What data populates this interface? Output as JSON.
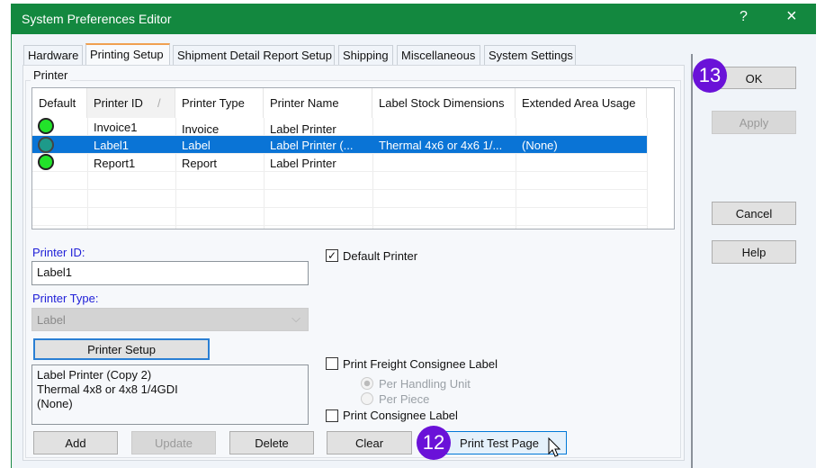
{
  "window": {
    "title": "System Preferences Editor",
    "help": "?",
    "close": "×"
  },
  "tabs": [
    {
      "label": "Hardware"
    },
    {
      "label": "Printing Setup"
    },
    {
      "label": "Shipment Detail Report Setup"
    },
    {
      "label": "Shipping"
    },
    {
      "label": "Miscellaneous"
    },
    {
      "label": "System Settings"
    }
  ],
  "group": {
    "label": "Printer"
  },
  "table": {
    "columns": [
      "Default",
      "Printer ID",
      "Printer Type",
      "Printer Name",
      "Label Stock Dimensions",
      "Extended Area Usage"
    ],
    "sort_indicator": "/",
    "rows": [
      {
        "id": "Invoice1",
        "type": "Invoice",
        "name": "Label  Printer",
        "stock": "",
        "ext": ""
      },
      {
        "id": "Label1",
        "type": "Label",
        "name": "Label  Printer  (...",
        "stock": "Thermal 4x6 or 4x6 1/...",
        "ext": "(None)"
      },
      {
        "id": "Report1",
        "type": "Report",
        "name": "Label  Printer",
        "stock": "",
        "ext": ""
      }
    ]
  },
  "form": {
    "printer_id_label": "Printer ID:",
    "printer_id_value": "Label1",
    "printer_type_label": "Printer Type:",
    "printer_type_value": "Label",
    "printer_setup": "Printer Setup",
    "info": [
      "Label Printer  (Copy 2)",
      "Thermal 4x8 or 4x8 1/4GDI",
      "(None)"
    ],
    "default_printer": "Default Printer",
    "default_checked": true,
    "freight_label": "Print Freight Consignee Label",
    "per_handling": "Per Handling Unit",
    "per_piece": "Per Piece",
    "consignee_label": "Print Consignee Label"
  },
  "buttons": {
    "add": "Add",
    "update": "Update",
    "delete": "Delete",
    "clear": "Clear",
    "print_test": "Print Test Page",
    "ok": "OK",
    "apply": "Apply",
    "cancel": "Cancel",
    "help": "Help"
  },
  "badges": {
    "b12": "12",
    "b13": "13"
  },
  "colors": {
    "title": "#13883f",
    "selection": "#0a74d6",
    "badge": "#6a12d8"
  }
}
